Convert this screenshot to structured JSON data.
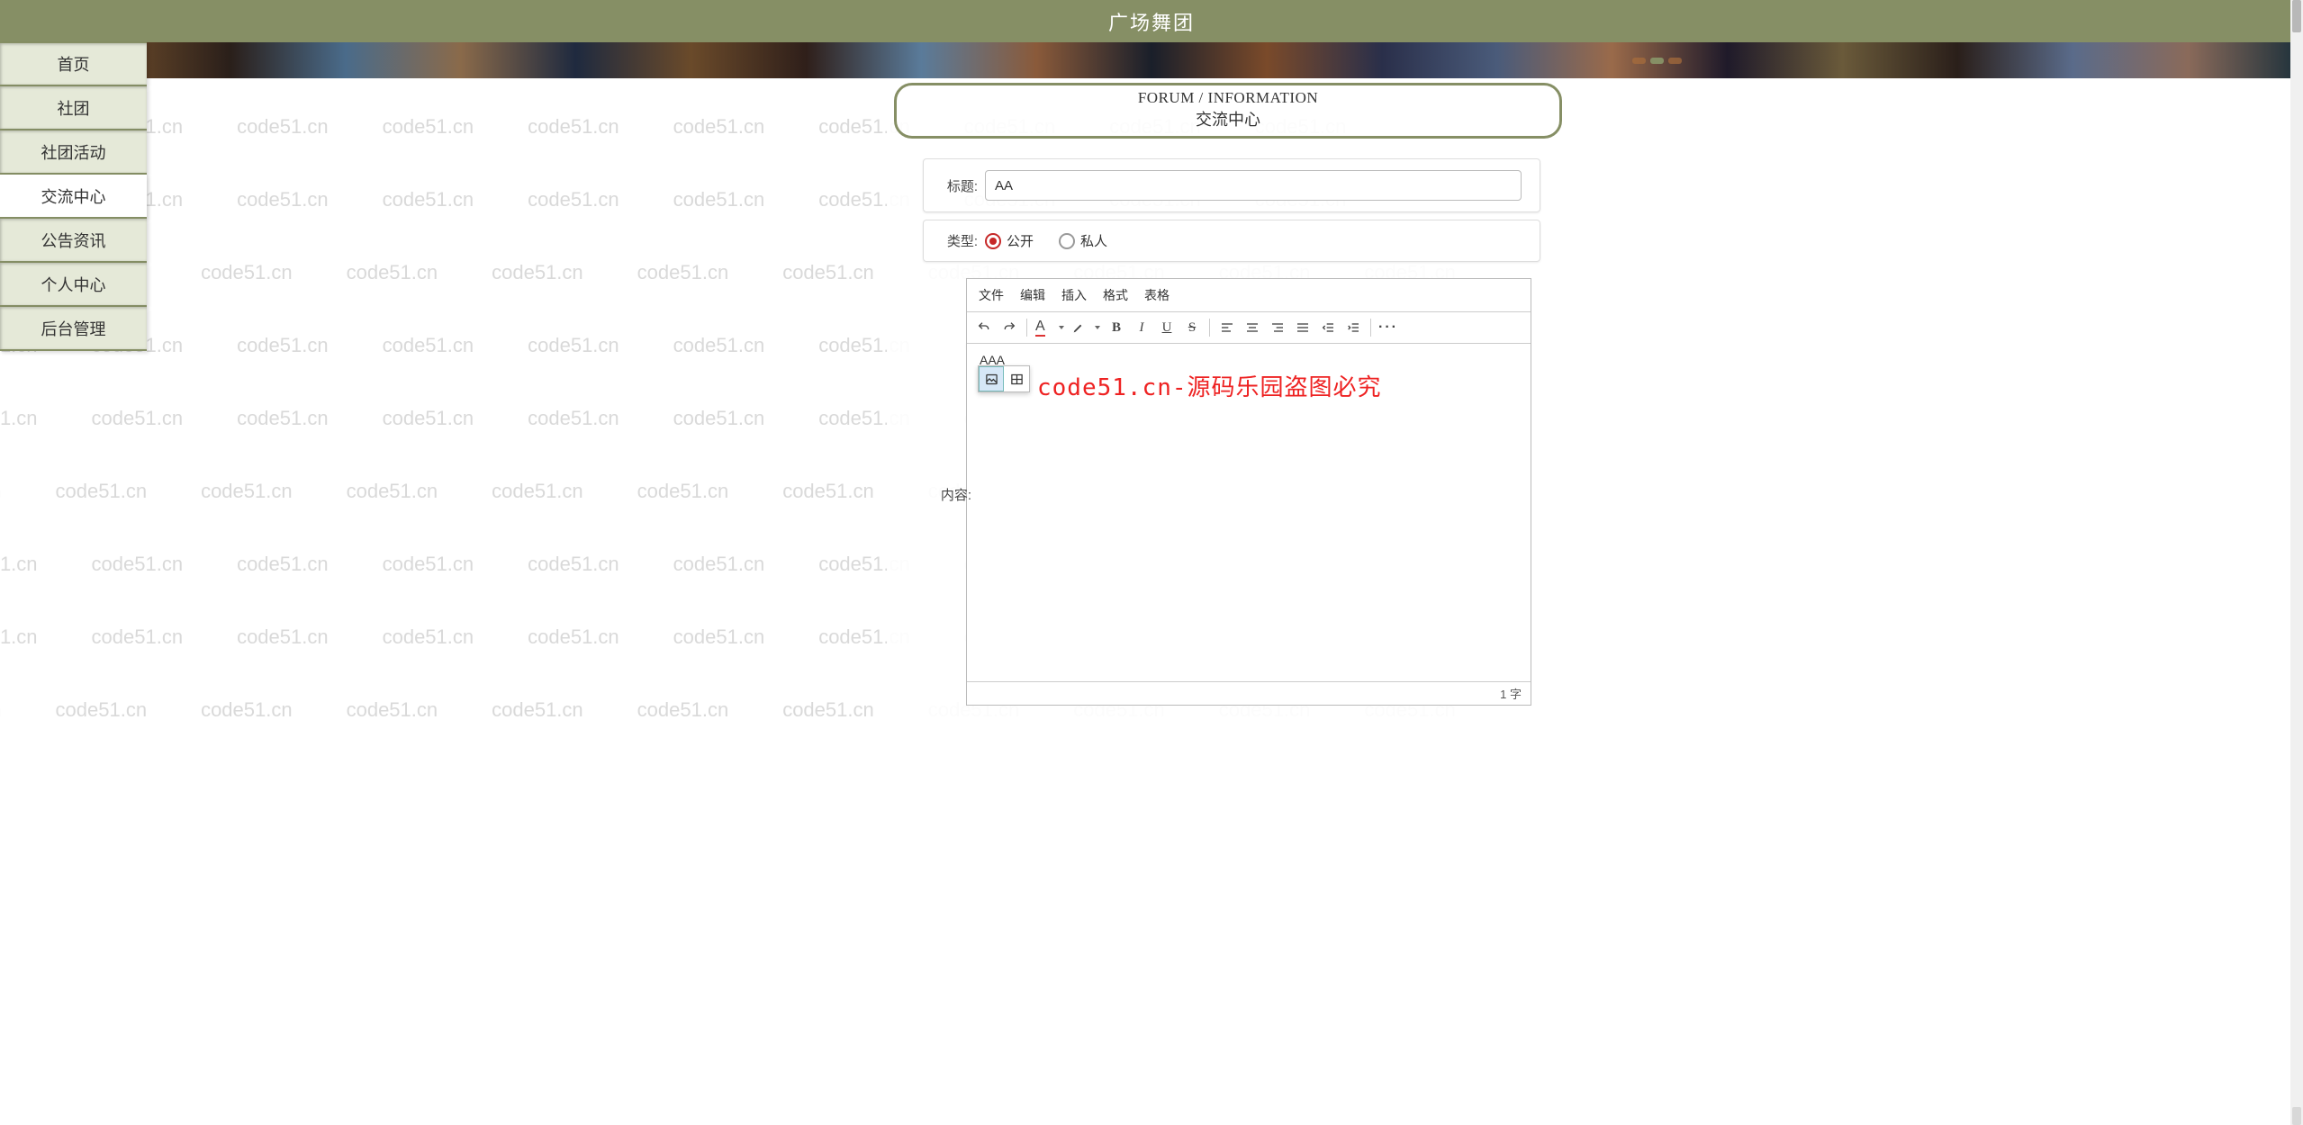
{
  "header": {
    "title": "广场舞团"
  },
  "sidebar": {
    "items": [
      {
        "label": "首页",
        "active": false
      },
      {
        "label": "社团",
        "active": false
      },
      {
        "label": "社团活动",
        "active": false
      },
      {
        "label": "交流中心",
        "active": true
      },
      {
        "label": "公告资讯",
        "active": false
      },
      {
        "label": "个人中心",
        "active": false
      },
      {
        "label": "后台管理",
        "active": false
      }
    ]
  },
  "section": {
    "english": "FORUM / INFORMATION",
    "chinese": "交流中心"
  },
  "form": {
    "title_label": "标题:",
    "title_value": "AA",
    "type_label": "类型:",
    "type_options": {
      "public": "公开",
      "private": "私人"
    },
    "type_selected": "public",
    "content_label": "内容:"
  },
  "editor": {
    "menus": {
      "file": "文件",
      "edit": "编辑",
      "insert": "插入",
      "format": "格式",
      "table": "表格"
    },
    "body_text": "AAA",
    "overlay_text": "code51.cn-源码乐园盗图必究",
    "wordcount": "1 字"
  },
  "watermark": "code51.cn"
}
